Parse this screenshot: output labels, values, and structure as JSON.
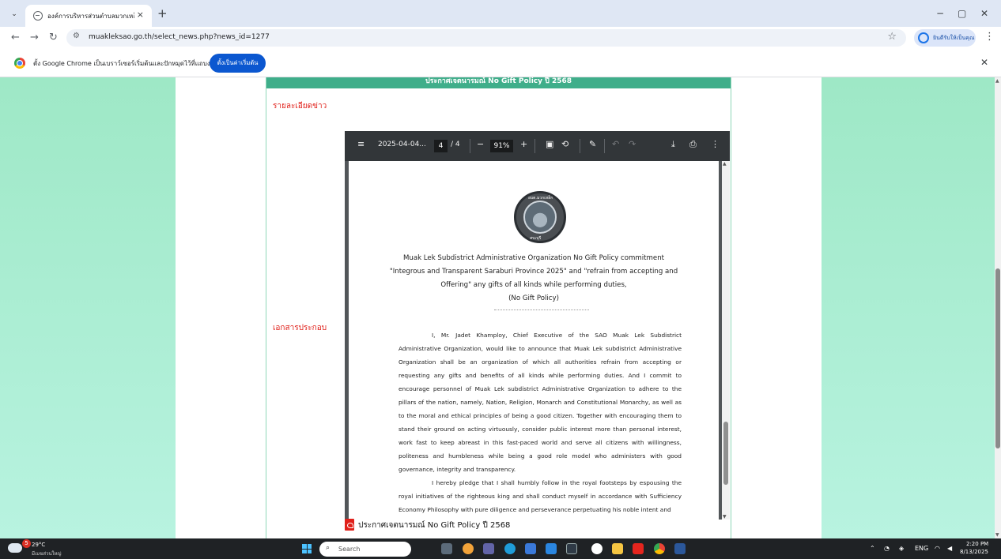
{
  "browser": {
    "tab_title": "องค์การบริหารส่วนตำบลมวกเหล็ก อำ",
    "tab_close": "×",
    "new_tab": "+",
    "url": "muakleksao.go.th/select_news.php?news_id=1277",
    "profile_label": "ยินดีรับให้เป็นคุณ",
    "infobar_text": "ตั้ง Google Chrome เป็นเบราว์เซอร์เริ่มต้นและปักหมุดไว้ที่แถบงาน",
    "infobar_button": "ตั้งเป็นค่าเริ่มต้น"
  },
  "page": {
    "header_title": "ประกาศเจตนารมณ์ No Gift Policy ปี 2568",
    "label_detail": "รายละเอียดข่าว",
    "label_attachments": "เอกสารประกอบ",
    "attachment_name": "ประกาศเจตนารมณ์ No Gift Policy ปี 2568"
  },
  "pdf": {
    "filename": "2025-04-04...",
    "current_page": "4",
    "total_pages": "/ 4",
    "zoom": "91%",
    "seal_text_top": "อบต.มวกเหล็ก",
    "seal_text_bottom": "สระบุรี",
    "title_lines": [
      "Muak Lek Subdistrict Administrative Organization No Gift Policy commitment",
      "\"Integrous and Transparent Saraburi Province 2025\"  and \"refrain from accepting and",
      "Offering\" any gifts of all kinds while performing duties,",
      "(No Gift Policy)"
    ],
    "paragraph_1": "I, Mr. Jadet  Khamploy, Chief Executive of the SAO Muak Lek Subdistrict Administrative Organization, would like to announce that Muak Lek subdistrict Administrative Organization shall be an organization of which all authorities refrain from accepting or requesting any gifts and benefits of all kinds while performing duties. And I commit to encourage personnel of Muak Lek subdistrict Administrative Organization to adhere to the pillars of the nation, namely, Nation, Religion, Monarch and Constitutional Monarchy, as well as to the moral and ethical principles of being a good citizen. Together with encouraging them to stand their ground on acting virtuously, consider public interest more than personal interest, work fast to keep abreast in this fast-paced world and serve all citizens with willingness, politeness and humbleness while being a good role model who administers with good governance, integrity and transparency.",
    "paragraph_2": "I hereby pledge that I shall humbly follow in the royal footsteps by espousing the royal initiatives of the righteous king and shall conduct myself in accordance with Sufficiency Economy Philosophy with pure diligence and perseverance perpetuating his noble intent and"
  },
  "taskbar": {
    "weather_badge": "5",
    "weather_temp": "29°C",
    "weather_desc": "มีเมฆส่วนใหญ่",
    "search_placeholder": "Search",
    "language": "ENG",
    "time": "2:20 PM",
    "date": "8/13/2025"
  }
}
